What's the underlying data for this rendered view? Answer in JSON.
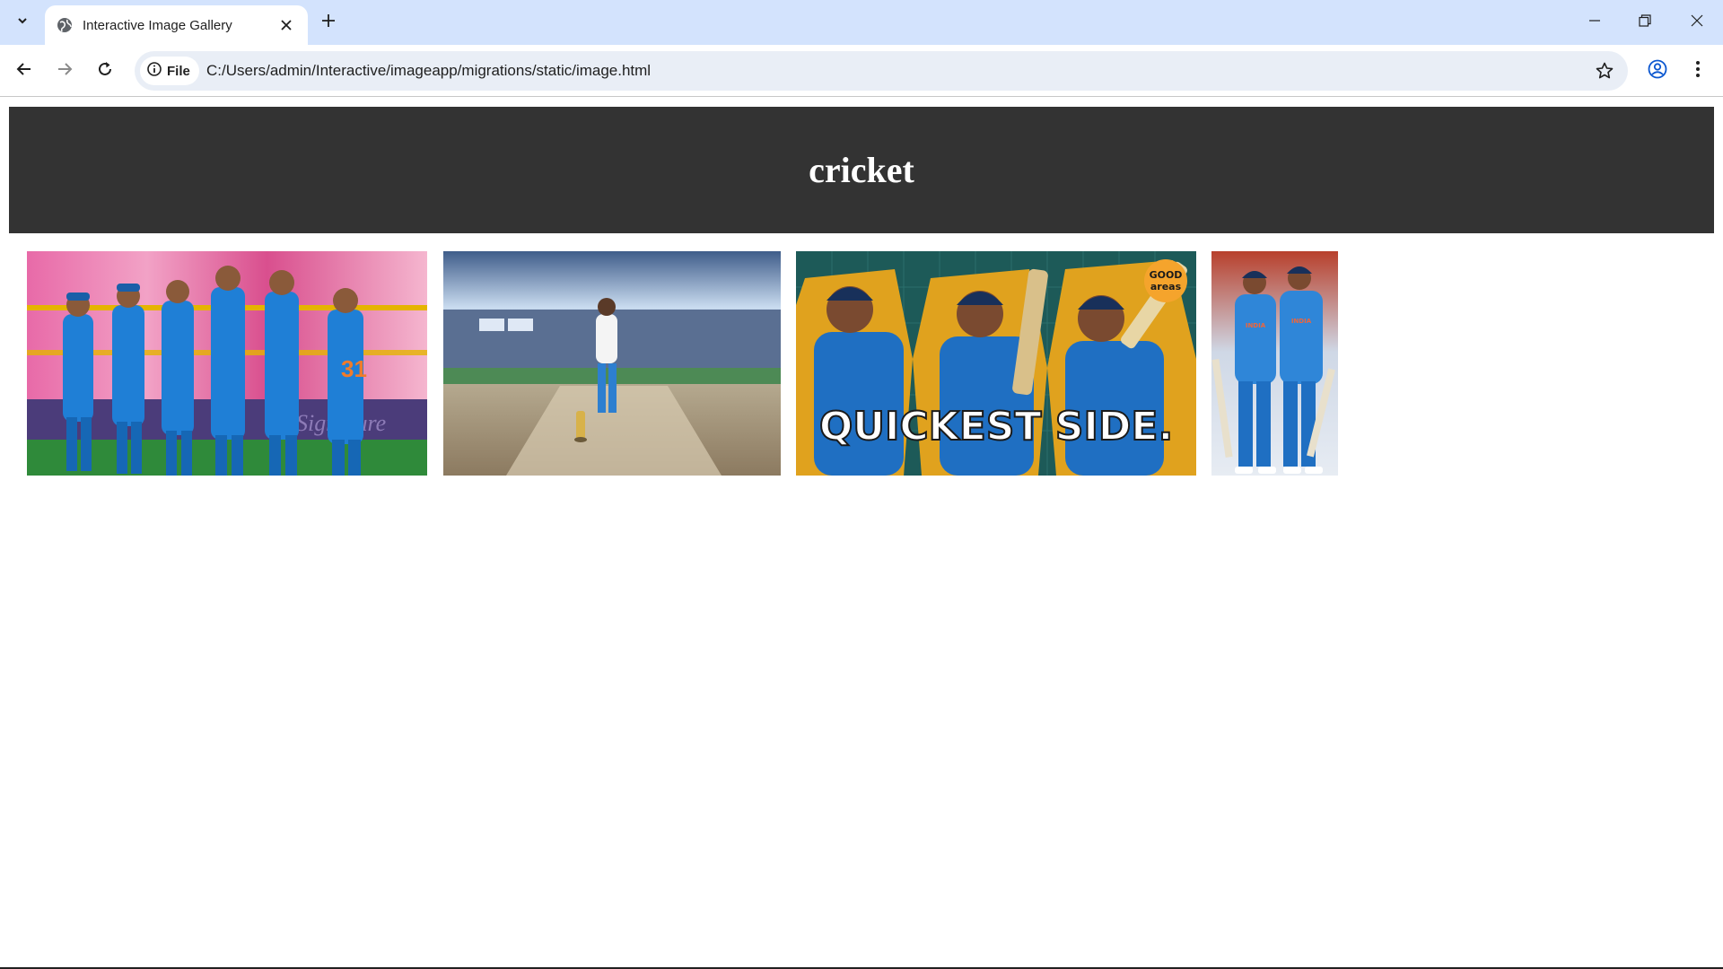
{
  "browser": {
    "tab_title": "Interactive Image Gallery",
    "address_chip": "File",
    "url": "C:/Users/admin/Interactive/imageapp/migrations/static/image.html"
  },
  "page": {
    "heading": "cricket",
    "header_bg": "#333333",
    "images": [
      {
        "name": "team-celebration-image",
        "kind": "team-in-blue-kits-celebrating"
      },
      {
        "name": "stadium-trophy-image",
        "kind": "man-in-white-suit-on-pitch-with-trophy"
      },
      {
        "name": "quickest-side-image",
        "kind": "three-batters-poster",
        "caption": "QUICKEST SIDE.",
        "badge": "GOOD areas"
      },
      {
        "name": "two-batters-image",
        "kind": "two-batters-in-blue"
      }
    ]
  }
}
